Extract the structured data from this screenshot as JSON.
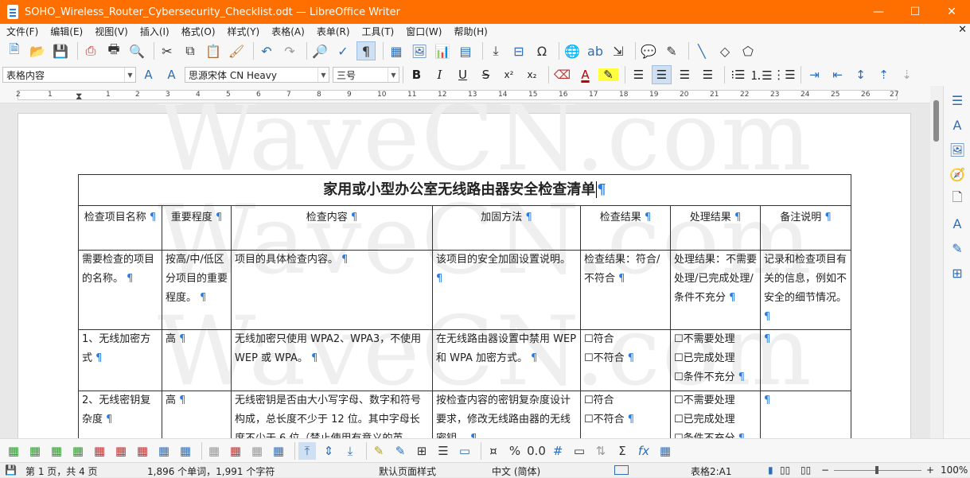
{
  "window": {
    "title": "SOHO_Wireless_Router_Cybersecurity_Checklist.odt — LibreOffice Writer",
    "minimize": "—",
    "maximize": "☐",
    "close": "✕"
  },
  "menu": {
    "items": [
      "文件(F)",
      "编辑(E)",
      "视图(V)",
      "插入(I)",
      "格式(O)",
      "样式(Y)",
      "表格(A)",
      "表单(R)",
      "工具(T)",
      "窗口(W)",
      "帮助(H)"
    ],
    "close_doc": "✕"
  },
  "format_bar": {
    "paragraph_style": "表格内容",
    "font_name": "思源宋体 CN Heavy",
    "font_size": "三号",
    "bold": "B",
    "italic": "I",
    "underline": "U",
    "strike": "S",
    "superscript": "x²",
    "subscript": "x₂"
  },
  "ruler": {
    "labels": [
      "2",
      "1",
      "1",
      "2",
      "3",
      "4",
      "5",
      "6",
      "7",
      "8",
      "9",
      "10",
      "11",
      "12",
      "13",
      "14",
      "15",
      "16",
      "17",
      "18",
      "19",
      "20",
      "21",
      "22",
      "23",
      "24",
      "25",
      "26",
      "27"
    ]
  },
  "watermark": {
    "text": "WaveCN.com"
  },
  "document": {
    "title": "家用或小型办公室无线路由器安全检查清单",
    "pilcrow": "¶",
    "headers": [
      "检查项目名称",
      "重要程度",
      "检查内容",
      "加固方法",
      "检查结果",
      "处理结果",
      "备注说明"
    ],
    "rows": [
      [
        "需要检查的项目的名称。",
        "按高/中/低区分项目的重要程度。",
        "项目的具体检查内容。",
        "该项目的安全加固设置说明。",
        "检查结果：符合/不符合",
        "处理结果：不需要处理/已完成处理/条件不充分",
        "记录和检查项目有关的信息，例如不安全的细节情况。"
      ],
      [
        "1、无线加密方式",
        "高",
        "无线加密只使用 WPA2、WPA3，不使用 WEP 或 WPA。",
        "在无线路由器设置中禁用 WEP 和 WPA 加密方式。",
        "☐符合\n☐不符合",
        "☐不需要处理\n☐已完成处理\n☐条件不充分",
        ""
      ],
      [
        "2、无线密钥复杂度",
        "高",
        "无线密钥是否由大小写字母、数字和符号构成，总长度不少于 12 位。其中字母长度不少于 6 位（禁止使用有意义的英",
        "按检查内容的密钥复杂度设计要求，修改无线路由器的无线密钥。",
        "☐符合\n☐不符合",
        "☐不需要处理\n☐已完成处理\n☐条件不充分",
        ""
      ]
    ]
  },
  "statusbar": {
    "page": "第 1 页，共 4 页",
    "words": "1,896 个单词，1,991 个字符",
    "page_style": "默认页面样式",
    "language": "中文 (简体)",
    "cell": "表格2:A1",
    "zoom": "100%"
  },
  "colors": {
    "titlebar": "#fe6f00",
    "accent": "#2a7be0"
  }
}
